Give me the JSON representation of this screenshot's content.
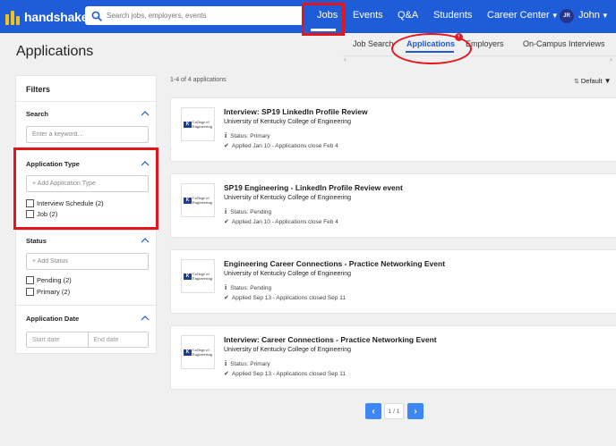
{
  "brand": {
    "name": "handshake",
    "logo_color": "#f4c21a",
    "nav_color": "#1f5dd8"
  },
  "search": {
    "placeholder": "Search jobs, employers, events",
    "icon": "search-icon"
  },
  "nav": {
    "jobs": "Jobs",
    "events": "Events",
    "qa": "Q&A",
    "students": "Students",
    "career_center": "Career Center",
    "user_initials": "JR",
    "user_name": "John"
  },
  "page": {
    "title": "Applications"
  },
  "subnav": {
    "job_search": "Job Search",
    "applications": "Applications",
    "notification_count": "1",
    "employers": "Employers",
    "on_campus": "On-Campus Interviews"
  },
  "filters": {
    "title": "Filters",
    "search": {
      "title": "Search",
      "placeholder": "Enter a keyword..."
    },
    "application_type": {
      "title": "Application Type",
      "placeholder": "+ Add Application Type",
      "options": [
        "Interview Schedule (2)",
        "Job (2)"
      ]
    },
    "status": {
      "title": "Status",
      "placeholder": "+ Add Status",
      "options": [
        "Pending (2)",
        "Primary (2)"
      ]
    },
    "application_date": {
      "title": "Application Date",
      "start_placeholder": "Start date",
      "end_placeholder": "End date"
    }
  },
  "results": {
    "count": "1-4 of 4 applications",
    "sort": "Default"
  },
  "applications": [
    {
      "title": "Interview: SP19 LinkedIn Profile Review",
      "org": "University of Kentucky College of Engineering",
      "status": "Status: Primary",
      "applied": "Applied Jan 10 - Applications close Feb 4"
    },
    {
      "title": "SP19 Engineering - LinkedIn Profile Review event",
      "org": "University of Kentucky College of Engineering",
      "status": "Status: Pending",
      "applied": "Applied Jan 10 - Applications close Feb 4"
    },
    {
      "title": "Engineering Career Connections - Practice Networking Event",
      "org": "University of Kentucky College of Engineering",
      "status": "Status: Pending",
      "applied": "Applied Sep 13 - Applications closed Sep 11"
    },
    {
      "title": "Interview: Career Connections - Practice Networking Event",
      "org": "University of Kentucky College of Engineering",
      "status": "Status: Primary",
      "applied": "Applied Sep 13 - Applications closed Sep 11"
    }
  ],
  "org_logo": {
    "mark": "K",
    "line1": "College of",
    "line2": "Engineering"
  },
  "pagination": {
    "label": "1 / 1"
  },
  "annotation_color": "#e8141b"
}
